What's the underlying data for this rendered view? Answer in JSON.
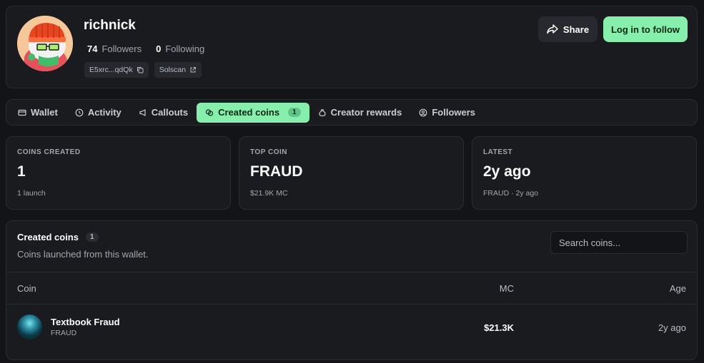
{
  "profile": {
    "username": "richnick",
    "followers_count": "74",
    "followers_label": "Followers",
    "following_count": "0",
    "following_label": "Following",
    "wallet_short": "E5xrc...qdQk",
    "solscan_label": "Solscan",
    "share_label": "Share",
    "follow_label": "Log in to follow"
  },
  "tabs": [
    {
      "label": "Wallet",
      "icon": "wallet-icon"
    },
    {
      "label": "Activity",
      "icon": "clock-icon"
    },
    {
      "label": "Callouts",
      "icon": "megaphone-icon"
    },
    {
      "label": "Created coins",
      "icon": "coins-icon",
      "count": "1",
      "active": true
    },
    {
      "label": "Creator rewards",
      "icon": "moneybag-icon"
    },
    {
      "label": "Followers",
      "icon": "user-circle-icon"
    }
  ],
  "stats": [
    {
      "label": "COINS CREATED",
      "value": "1",
      "sub": "1 launch"
    },
    {
      "label": "TOP COIN",
      "value": "FRAUD",
      "sub": "$21.9K MC"
    },
    {
      "label": "LATEST",
      "value": "2y ago",
      "sub": "FRAUD · 2y ago"
    }
  ],
  "coins_section": {
    "title": "Created coins",
    "count": "1",
    "description": "Coins launched from this wallet.",
    "search_placeholder": "Search coins...",
    "columns": {
      "coin": "Coin",
      "mc": "MC",
      "age": "Age"
    },
    "rows": [
      {
        "name": "Textbook Fraud",
        "ticker": "FRAUD",
        "mc": "$21.3K",
        "age": "2y ago"
      }
    ]
  },
  "colors": {
    "accent": "#86efac",
    "background": "#131417",
    "card": "#1a1b1f"
  }
}
